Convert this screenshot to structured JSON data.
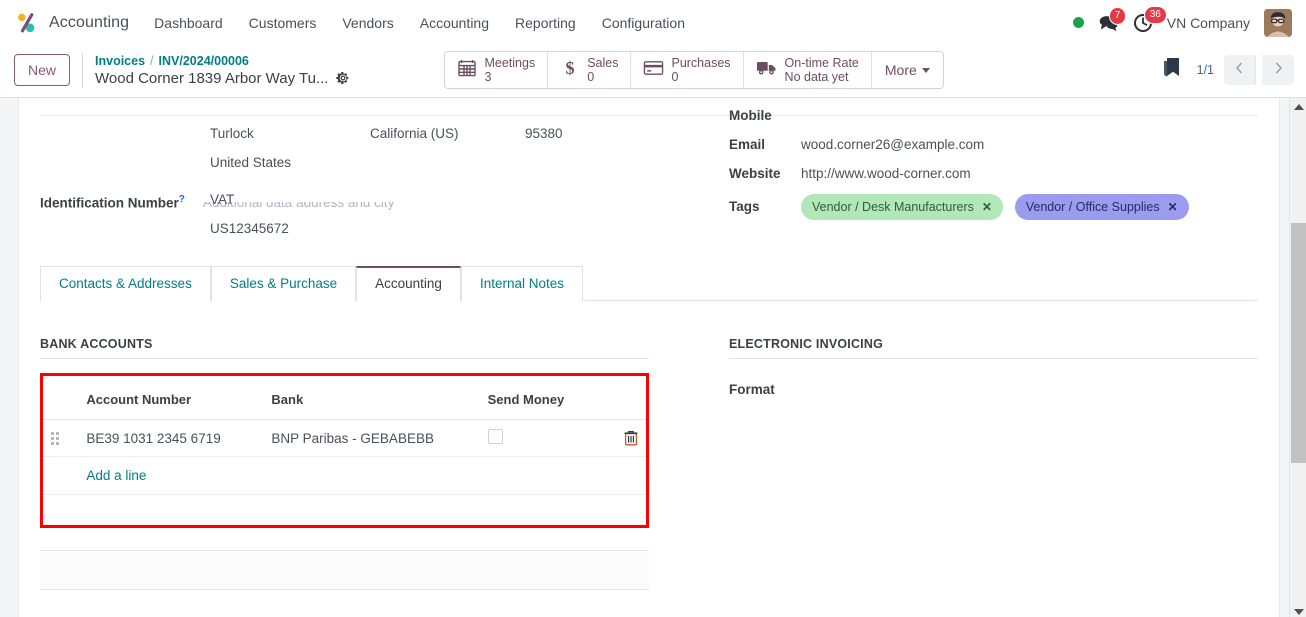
{
  "navbar": {
    "brand": "Accounting",
    "brand_logo_icon": "odoo-logo-icon",
    "menu": [
      {
        "label": "Dashboard",
        "name": "nav-item-dashboard"
      },
      {
        "label": "Customers",
        "name": "nav-item-customers"
      },
      {
        "label": "Vendors",
        "name": "nav-item-vendors"
      },
      {
        "label": "Accounting",
        "name": "nav-item-accounting"
      },
      {
        "label": "Reporting",
        "name": "nav-item-reporting"
      },
      {
        "label": "Configuration",
        "name": "nav-item-configuration"
      }
    ],
    "status_dot_color": "#16a34a",
    "messages_badge": "7",
    "activities_badge": "36",
    "company": "VN Company",
    "avatar_icon": "user-avatar"
  },
  "control_panel": {
    "new_label": "New",
    "breadcrumb": {
      "parent": "Invoices",
      "separator": "/",
      "current": "INV/2024/00006",
      "record_title": "Wood Corner 1839 Arbor Way Tu...",
      "gear_icon": "gear-icon"
    },
    "smart_buttons": [
      {
        "icon": "calendar-icon",
        "label": "Meetings",
        "value": "3",
        "name": "smart-button-meetings"
      },
      {
        "icon": "dollar-icon",
        "label": "Sales",
        "value": "0",
        "name": "smart-button-sales"
      },
      {
        "icon": "credit-card-icon",
        "label": "Purchases",
        "value": "0",
        "name": "smart-button-purchases"
      },
      {
        "icon": "truck-icon",
        "label": "On-time Rate",
        "value": "No data yet",
        "name": "smart-button-on-time-rate"
      }
    ],
    "more_label": "More",
    "bookmark_icon": "bookmark-icon",
    "pager": {
      "current": "1",
      "slash": "/",
      "total": "1",
      "prev_icon": "chevron-left-icon",
      "next_icon": "chevron-right-icon"
    }
  },
  "form": {
    "cut_placeholder": "Additional data address and city",
    "address": {
      "city": "Turlock",
      "state": "California (US)",
      "zip": "95380",
      "country": "United States"
    },
    "identification": {
      "label": "Identification Number",
      "help_icon": "?",
      "type": "VAT",
      "value": "US12345672"
    },
    "mobile": {
      "label": "Mobile",
      "value": ""
    },
    "email": {
      "label": "Email",
      "value": "wood.corner26@example.com"
    },
    "website": {
      "label": "Website",
      "value": "http://www.wood-corner.com"
    },
    "tags": {
      "label": "Tags",
      "items": [
        {
          "label": "Vendor / Desk Manufacturers",
          "bg": "#b2e7b8",
          "fg": "#2d5f35",
          "close": "✕"
        },
        {
          "label": "Vendor / Office Supplies",
          "bg": "#9b9bef",
          "fg": "#2a2a66",
          "close": "✕"
        }
      ]
    }
  },
  "tabs": [
    {
      "label": "Contacts & Addresses",
      "active": false,
      "name": "tab-contacts-addresses"
    },
    {
      "label": "Sales & Purchase",
      "active": false,
      "name": "tab-sales-purchase"
    },
    {
      "label": "Accounting",
      "active": true,
      "name": "tab-accounting"
    },
    {
      "label": "Internal Notes",
      "active": false,
      "name": "tab-internal-notes"
    }
  ],
  "bank_accounts": {
    "section_title": "BANK ACCOUNTS",
    "columns": [
      "Account Number",
      "Bank",
      "Send Money"
    ],
    "rows": [
      {
        "account_number": "BE39 1031 2345 6719",
        "bank": "BNP Paribas - GEBABEBB",
        "send_money_checked": false,
        "drag_icon": "drag-handle-icon",
        "trash_icon": "trash-icon"
      }
    ],
    "add_line_label": "Add a line",
    "highlight_color": "#ff0000"
  },
  "electronic_invoicing": {
    "section_title": "ELECTRONIC INVOICING",
    "format_label": "Format",
    "format_value": ""
  }
}
